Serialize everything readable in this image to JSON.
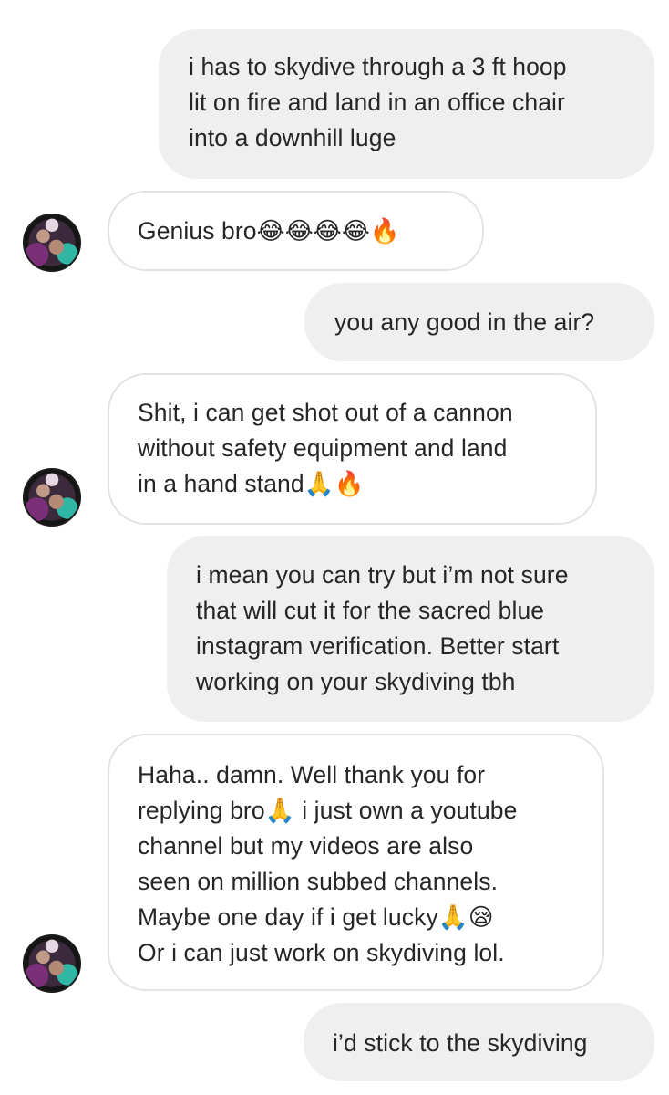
{
  "thread": {
    "messages": [
      {
        "side": "sent",
        "text": "i has to skydive through a 3 ft hoop\nlit on fire and land in an office chair\ninto a downhill luge"
      },
      {
        "side": "received",
        "text": "Genius bro😂😂😂😂🔥"
      },
      {
        "side": "sent",
        "text": "you any good in the air?"
      },
      {
        "side": "received",
        "text": "Shit, i can get shot out of a cannon\nwithout safety equipment and land\nin a hand stand🙏🔥"
      },
      {
        "side": "sent",
        "text": "i mean you can try but i’m not sure\nthat will cut it for the sacred blue\ninstagram verification. Better start\nworking on your skydiving tbh"
      },
      {
        "side": "received",
        "text": "Haha.. damn. Well thank you for\nreplying bro🙏 i just own a youtube\nchannel but my videos are also\nseen on million subbed channels.\nMaybe one day if i get lucky🙏😪\nOr i can just work on skydiving lol."
      },
      {
        "side": "sent",
        "text": "i’d stick to the skydiving"
      }
    ],
    "avatar_icon": "profile-photo-avatar"
  },
  "colors": {
    "sent_bubble": "#efefef",
    "received_border": "#e3e3e3",
    "text": "#262626"
  }
}
